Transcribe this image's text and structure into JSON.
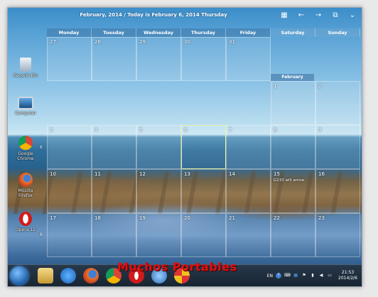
{
  "calendar": {
    "title": "February, 2014 / Today is February 6, 2014 Thursday",
    "weekdays": [
      "Monday",
      "Tuesday",
      "Wednesday",
      "Thursday",
      "Friday",
      "Saturday",
      "Sunday"
    ],
    "mini_month": "February",
    "week_numbers": [
      "6",
      "8"
    ],
    "rows": [
      [
        "27",
        "28",
        "29",
        "30",
        "31",
        "",
        ""
      ],
      [
        "",
        "",
        "",
        "",
        "",
        "1",
        "2"
      ],
      [
        "3",
        "4",
        "5",
        "6",
        "7",
        "8",
        "9"
      ],
      [
        "10",
        "11",
        "12",
        "13",
        "14",
        "15",
        "16"
      ],
      [
        "17",
        "18",
        "19",
        "20",
        "21",
        "22",
        "23"
      ]
    ],
    "event_text": "G133 will arrive.",
    "today_day": "6"
  },
  "desktop_icons": [
    {
      "label": "Recycle Bin"
    },
    {
      "label": "Computer"
    },
    {
      "label": "Google Chrome"
    },
    {
      "label": "Mozilla Firefox"
    },
    {
      "label": "Opera 12"
    }
  ],
  "taskbar": {
    "lang": "EN",
    "time": "21:53",
    "date": "2014/2/6"
  },
  "watermark": "Muchos Portables"
}
